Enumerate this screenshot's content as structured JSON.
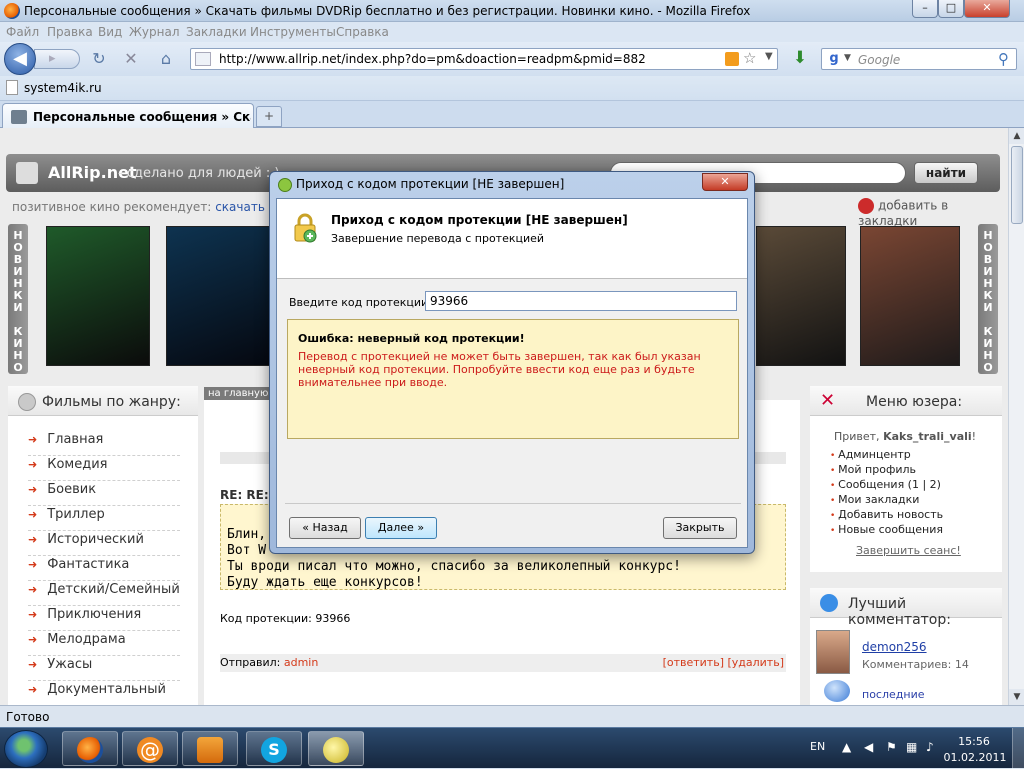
{
  "window": {
    "title": "Персональные сообщения » Скачать фильмы DVDRip бесплатно и без регистрации. Новинки кино. - Mozilla Firefox",
    "min": "–",
    "max": "□",
    "close": "✕"
  },
  "menu": [
    "Файл",
    "Правка",
    "Вид",
    "Журнал",
    "Закладки",
    "Инструменты",
    "Справка"
  ],
  "nav": {
    "url": "http://www.allrip.net/index.php?do=pm&doaction=readpm&pmid=882",
    "search_placeholder": "Google",
    "back": "◀",
    "forward": "▸",
    "reload": "↻",
    "stop": "✕",
    "home": "⌂",
    "download": "⬇",
    "google_letter": "g"
  },
  "bookmarks": {
    "item": "system4ik.ru"
  },
  "tab": {
    "label": "Персональные сообщения » Скача...",
    "new_tab": "+"
  },
  "site": {
    "brand": "AllRip.net",
    "slogan": "- сделано для людей : )",
    "find_button": "найти",
    "recommend_prefix": "позитивное кино рекомендует:",
    "recommend_link": "скачать фил",
    "add_bookmark": "добавить в закладки",
    "vstrip_left": "Н\nО\nВ\nИ\nН\nК\nИ\n \nК\nИ\nН\nО",
    "vstrip_right": "Н\nО\nВ\nИ\nН\nК\nИ\n \nК\nИ\nН\nО",
    "posters": [
      {
        "color1": "#1a3a1a",
        "color2": "#0d0d0d"
      },
      {
        "color1": "#0b2236",
        "color2": "#0a0a12"
      },
      {
        "color1": "#3a2a1a",
        "color2": "#111"
      },
      {
        "color1": "#6a3b2a",
        "color2": "#1b1b1b"
      }
    ],
    "genre_title": "Фильмы по жанру:",
    "genres": [
      "Главная",
      "Комедия",
      "Боевик",
      "Триллер",
      "Исторический",
      "Фантастика",
      "Детский/Семейный",
      "Приключения",
      "Мелодрама",
      "Ужасы",
      "Документальный"
    ],
    "crumb": "на главную",
    "re_title": "RE: RE:",
    "quote": "Блин,\nВот W\nТы вроди писал что можно, спасибо за великолепный конкурс!\nБуду ждать еще конкурсов!",
    "code_line": "Код протекции: 93966",
    "sent_by_label": "Отправил:",
    "sent_by_user": "admin",
    "reply": "[ответить]",
    "delete": "[удалить]",
    "user_menu_title": "Меню юзера:",
    "hello_prefix": "Привет,",
    "hello_user": "Kaks_trali_vali",
    "user_menu": [
      "Админцентр",
      "Мой профиль",
      "Сообщения (1 | 2)",
      "Мои закладки",
      "Добавить новость",
      "Новые сообщения"
    ],
    "logout": "Завершить сеанс!",
    "commenter_title": "Лучший комментатор:",
    "commenter_name": "demon256",
    "commenter_count": "Комментариев: 14",
    "last_comments": "последние комментарии"
  },
  "dialog": {
    "caption": "Приход с кодом протекции [НЕ завершен]",
    "close": "✕",
    "title": "Приход с кодом протекции [НЕ завершен]",
    "subtitle": "Завершение перевода с протекцией",
    "code_label": "Введите код протекции:",
    "code_value": "93966",
    "error_title": "Ошибка: неверный код протекции!",
    "error_message": "Перевод с протекцией не может быть завершен, так как был указан неверный код протекции. Попробуйте ввести код еще раз и будьте внимательнее при вводе.",
    "back_button": "« Назад",
    "next_button": "Далее »",
    "close_button": "Закрыть"
  },
  "status": {
    "text": "Готово"
  },
  "taskbar": {
    "lang": "EN",
    "time": "15:56",
    "date": "01.02.2011"
  },
  "colors": {
    "accent": "#d43a1a",
    "link": "#2a55a8",
    "error": "#cc1a1a",
    "error_bg": "#fdf4c7"
  }
}
